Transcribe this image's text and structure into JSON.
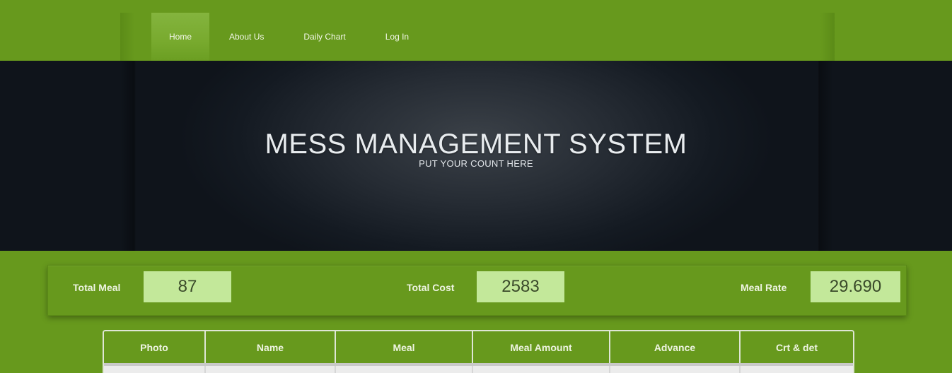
{
  "nav": {
    "items": [
      {
        "label": "Home",
        "active": true
      },
      {
        "label": "About Us",
        "active": false
      },
      {
        "label": "Daily Chart",
        "active": false
      },
      {
        "label": "Log In",
        "active": false
      }
    ]
  },
  "banner": {
    "title": "MESS MANAGEMENT SYSTEM",
    "subtitle": "PUT YOUR COUNT HERE"
  },
  "stats": {
    "total_meal": {
      "label": "Total Meal",
      "value": "87"
    },
    "total_cost": {
      "label": "Total Cost",
      "value": "2583"
    },
    "meal_rate": {
      "label": "Meal Rate",
      "value": "29.690"
    }
  },
  "table": {
    "columns": [
      "Photo",
      "Name",
      "Meal",
      "Meal Amount",
      "Advance",
      "Crt & det"
    ]
  },
  "colors": {
    "brand_green": "#67991d",
    "stat_value_bg": "#c3e89a",
    "banner_dark": "#141a22"
  }
}
